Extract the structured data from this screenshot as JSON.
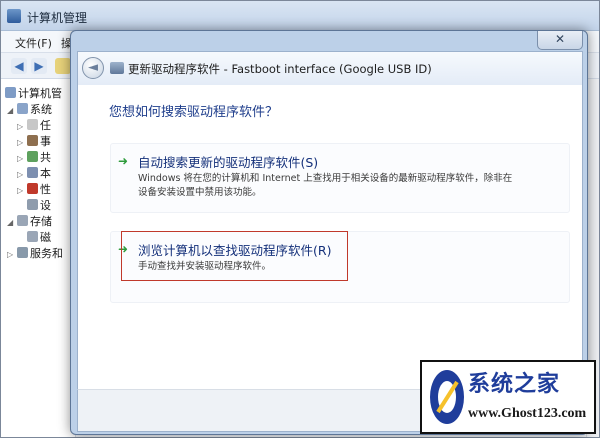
{
  "background_window": {
    "title": "计算机管理",
    "menu": [
      "文件(F)",
      "操作(A)"
    ],
    "tree": [
      {
        "label": "计算机管",
        "level": 0
      },
      {
        "label": "系统",
        "level": 1
      },
      {
        "label": "任",
        "level": 2
      },
      {
        "label": "事",
        "level": 2
      },
      {
        "label": "共",
        "level": 2
      },
      {
        "label": "本",
        "level": 2
      },
      {
        "label": "性",
        "level": 2
      },
      {
        "label": "设",
        "level": 2
      },
      {
        "label": "存储",
        "level": 1
      },
      {
        "label": "磁",
        "level": 2
      },
      {
        "label": "服务和",
        "level": 1
      }
    ]
  },
  "dialog": {
    "close_glyph": "✕",
    "back_glyph": "◄",
    "header_title": "更新驱动程序软件 - Fastboot interface (Google USB ID)",
    "question": "您想如何搜索驱动程序软件？",
    "options": [
      {
        "title": "自动搜索更新的驱动程序软件(S)",
        "description": "Windows 将在您的计算机和 Internet 上查找用于相关设备的最新驱动程序软件，除非在设备安装设置中禁用该功能。"
      },
      {
        "title": "浏览计算机以查找驱动程序软件(R)",
        "description": "手动查找并安装驱动程序软件。"
      }
    ],
    "option_arrow_glyph": "➜",
    "accent_colors": {
      "link": "#14307a",
      "question": "#1f3e8c",
      "arrow": "#2e9b3b",
      "highlight": "#c0392b"
    }
  },
  "watermark": {
    "name": "系统之家",
    "url": "www.Ghost123.com"
  }
}
